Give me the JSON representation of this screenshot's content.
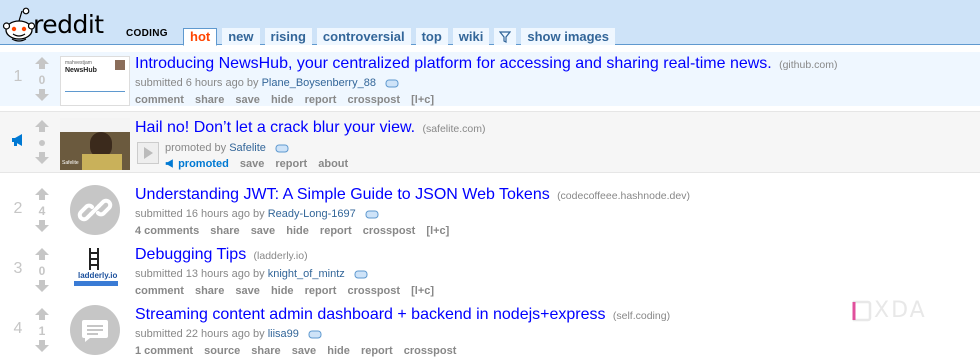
{
  "header": {
    "logo_text": "reddit",
    "subreddit": "CODING",
    "tabs": [
      {
        "label": "hot"
      },
      {
        "label": "new"
      },
      {
        "label": "rising"
      },
      {
        "label": "controversial"
      },
      {
        "label": "top"
      },
      {
        "label": "wiki"
      },
      {
        "label": "",
        "icon": "filter-icon"
      },
      {
        "label": "show images"
      }
    ],
    "selected_tab": "hot"
  },
  "posts": [
    {
      "rank": "1",
      "score": "0",
      "title": "Introducing NewsHub, your centralized platform for accessing and sharing real-time news.",
      "domain": "(github.com)",
      "tagline": {
        "prefix": "submitted 6 hours ago by",
        "author": "Plane_Boysenberry_88"
      },
      "thumbnail": {
        "heading": "NewsHub",
        "small": "mahvestjam"
      },
      "buttons": [
        "comment",
        "share",
        "save",
        "hide",
        "report",
        "crosspost",
        "[l+c]"
      ]
    },
    {
      "rank": "",
      "score": "",
      "title": "Hail no! Don’t let a crack blur your view.",
      "domain": "(safelite.com)",
      "tagline": {
        "prefix": "promoted by",
        "author": "Safelite"
      },
      "thumbnail": {
        "caption": "Safelite"
      },
      "buttons": [
        "promoted",
        "save",
        "report",
        "about"
      ]
    },
    {
      "rank": "2",
      "score": "4",
      "title": "Understanding JWT: A Simple Guide to JSON Web Tokens",
      "domain": "(codecoffeee.hashnode.dev)",
      "tagline": {
        "prefix": "submitted 16 hours ago by",
        "author": "Ready-Long-1697"
      },
      "buttons": [
        "4 comments",
        "share",
        "save",
        "hide",
        "report",
        "crosspost",
        "[l+c]"
      ]
    },
    {
      "rank": "3",
      "score": "0",
      "title": "Debugging Tips",
      "domain": "(ladderly.io)",
      "tagline": {
        "prefix": "submitted 13 hours ago by",
        "author": "knight_of_mintz"
      },
      "thumbnail": {
        "caption": "ladderly.io"
      },
      "buttons": [
        "comment",
        "share",
        "save",
        "hide",
        "report",
        "crosspost",
        "[l+c]"
      ]
    },
    {
      "rank": "4",
      "score": "1",
      "title": "Streaming content admin dashboard + backend in nodejs+express",
      "domain": "(self.coding)",
      "tagline": {
        "prefix": "submitted 22 hours ago by",
        "author": "liisa99"
      },
      "buttons": [
        "1 comment",
        "source",
        "share",
        "save",
        "hide",
        "report",
        "crosspost"
      ]
    }
  ],
  "watermark": "XDA",
  "colors": {
    "link": "#0000ff",
    "accent": "#ff4500",
    "header_bg": "#cee3f8",
    "arrow": "#c6c6c6"
  }
}
